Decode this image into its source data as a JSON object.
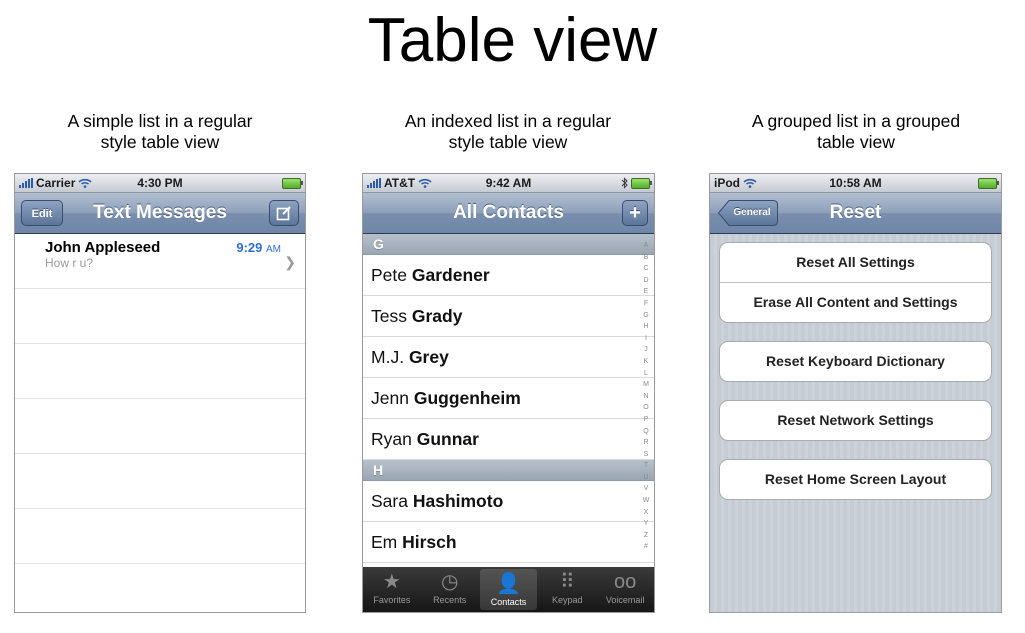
{
  "page": {
    "title": "Table view"
  },
  "captions": [
    {
      "line1": "A simple list in a regular",
      "line2": "style table view"
    },
    {
      "line1": "An indexed list in a regular",
      "line2": "style table view"
    },
    {
      "line1": "A grouped list in a grouped",
      "line2": "table view"
    }
  ],
  "phone1": {
    "status": {
      "carrier": "Carrier",
      "time": "4:30 PM"
    },
    "nav": {
      "edit_label": "Edit",
      "title": "Text Messages",
      "compose_icon": "compose-icon"
    },
    "message": {
      "name": "John Appleseed",
      "time": "9:29",
      "ampm": "AM",
      "preview": "How r u?"
    },
    "empty_rows": 6
  },
  "phone2": {
    "status": {
      "carrier": "AT&T",
      "time": "9:42 AM"
    },
    "nav": {
      "title": "All Contacts",
      "add_label": "+"
    },
    "sections": [
      {
        "header": "G",
        "contacts": [
          {
            "first": "Pete",
            "last": "Gardener"
          },
          {
            "first": "Tess",
            "last": "Grady"
          },
          {
            "first": "M.J.",
            "last": "Grey"
          },
          {
            "first": "Jenn",
            "last": "Guggenheim"
          },
          {
            "first": "Ryan",
            "last": "Gunnar"
          }
        ]
      },
      {
        "header": "H",
        "contacts": [
          {
            "first": "Sara",
            "last": "Hashimoto"
          },
          {
            "first": "Em",
            "last": "Hirsch"
          }
        ]
      }
    ],
    "index": [
      "A",
      "B",
      "C",
      "D",
      "E",
      "F",
      "G",
      "H",
      "I",
      "J",
      "K",
      "L",
      "M",
      "N",
      "O",
      "P",
      "Q",
      "R",
      "S",
      "T",
      "U",
      "V",
      "W",
      "X",
      "Y",
      "Z",
      "#"
    ],
    "tabs": [
      {
        "label": "Favorites",
        "icon": "★",
        "selected": false
      },
      {
        "label": "Recents",
        "icon": "◷",
        "selected": false
      },
      {
        "label": "Contacts",
        "icon": "👤",
        "selected": true
      },
      {
        "label": "Keypad",
        "icon": "⠿",
        "selected": false
      },
      {
        "label": "Voicemail",
        "icon": "oo",
        "selected": false
      }
    ]
  },
  "phone3": {
    "status": {
      "carrier": "iPod",
      "time": "10:58 AM"
    },
    "nav": {
      "back_label": "General",
      "title": "Reset"
    },
    "groups": [
      [
        "Reset All Settings",
        "Erase All Content and Settings"
      ],
      [
        "Reset Keyboard Dictionary"
      ],
      [
        "Reset Network Settings"
      ],
      [
        "Reset Home Screen Layout"
      ]
    ]
  },
  "colors": {
    "nav_blue": "#7a8fae",
    "time_blue": "#2f6fd6",
    "selected_tab_blue": "#4fa3ff"
  }
}
